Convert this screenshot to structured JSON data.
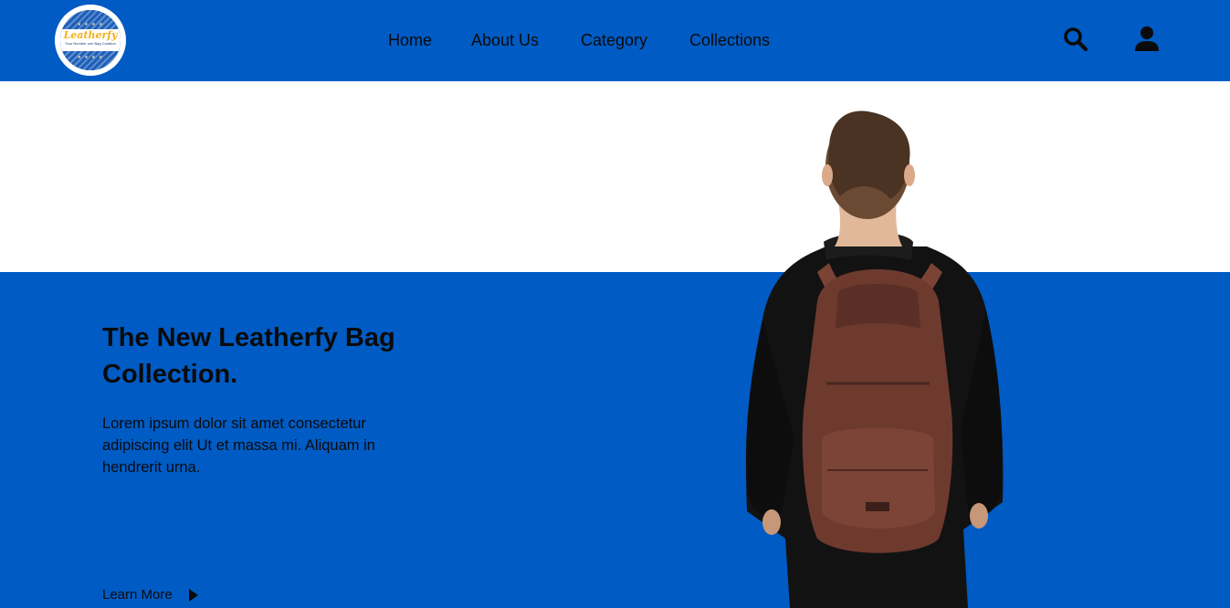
{
  "brand": {
    "logo_name": "Leatherfy",
    "logo_tagline": "Your Number one Bag Curation",
    "logo_stars": "★ ★ ★ ★",
    "icon": "logo-badge"
  },
  "nav": {
    "items": [
      {
        "label": "Home"
      },
      {
        "label": "About Us"
      },
      {
        "label": "Category"
      },
      {
        "label": "Collections"
      }
    ]
  },
  "actions": {
    "search_icon": "search-icon",
    "user_icon": "user-icon"
  },
  "hero": {
    "title": "The New Leatherfy Bag Collection.",
    "body": "Lorem ipsum dolor sit amet consectetur adipiscing elit Ut et massa mi. Aliquam in hendrerit urna.",
    "cta_label": "Learn More",
    "cta_icon": "play-arrow-icon",
    "image": "person-with-backpack-photo"
  },
  "colors": {
    "primary": "#005bc4",
    "text": "#0b0b0b",
    "background": "#ffffff",
    "logo_accent": "#f2b01e"
  }
}
